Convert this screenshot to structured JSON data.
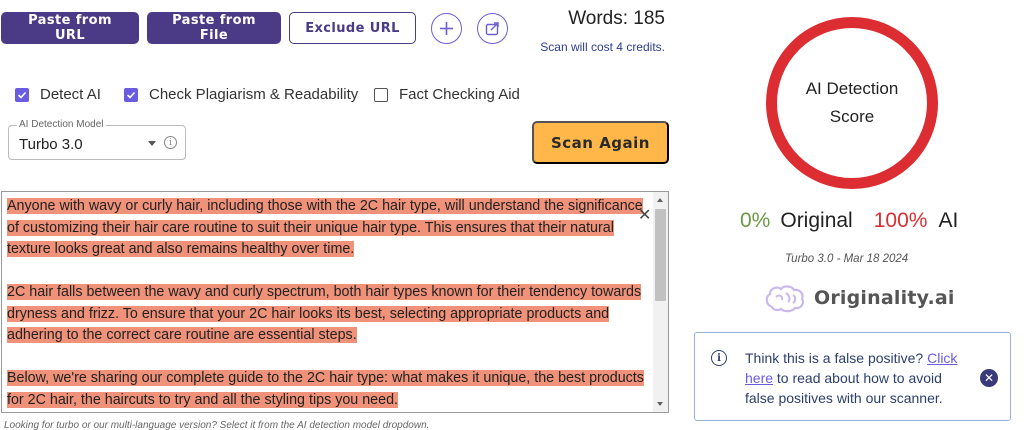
{
  "toolbar": {
    "paste_url_label": "Paste from URL",
    "paste_file_label": "Paste from File",
    "exclude_url_label": "Exclude URL",
    "word_count_text": "Words: 185",
    "credits_text": "Scan will cost 4 credits."
  },
  "options": {
    "detect_ai": {
      "label": "Detect AI",
      "checked": true
    },
    "plagiarism": {
      "label": "Check Plagiarism & Readability",
      "checked": true
    },
    "fact_check": {
      "label": "Fact Checking Aid",
      "checked": false
    }
  },
  "model_select": {
    "legend": "AI Detection Model",
    "value": "Turbo 3.0"
  },
  "scan_button_label": "Scan Again",
  "content": {
    "paragraphs": [
      "Anyone with wavy or curly hair, including those with the 2C hair type, will understand the significance of customizing their hair care routine to suit their unique hair type. This ensures that their natural texture looks great and also remains healthy over time.",
      "2C hair falls between the wavy and curly spectrum, both hair types known for their tendency towards dryness and frizz. To ensure that your 2C hair looks its best, selecting appropriate products and adhering to the correct care routine are essential steps.",
      "Below, we're sharing our complete guide to the 2C hair type: what makes it unique, the best products for 2C hair, the haircuts to try and all the styling tips you need."
    ],
    "hint": "Looking for turbo or our multi-language version? Select it from the AI detection model dropdown."
  },
  "result": {
    "score_title": "AI Detection Score",
    "original_pct": "0%",
    "original_label": "Original",
    "ai_pct": "100%",
    "ai_label": "AI",
    "model_date": "Turbo 3.0 - Mar 18 2024",
    "brand": "Originality.ai"
  },
  "false_positive": {
    "text_before": "Think this is a false positive?",
    "link_text": "Click here",
    "text_after": "to read about how to avoid false positives with our scanner."
  },
  "colors": {
    "primary": "#4b3b86",
    "accent": "#6a5ce0",
    "scan_button": "#ffb74a",
    "highlight_ai": "#f0927a",
    "score_ring": "#dc2e32",
    "original_green": "#6a9a46"
  }
}
